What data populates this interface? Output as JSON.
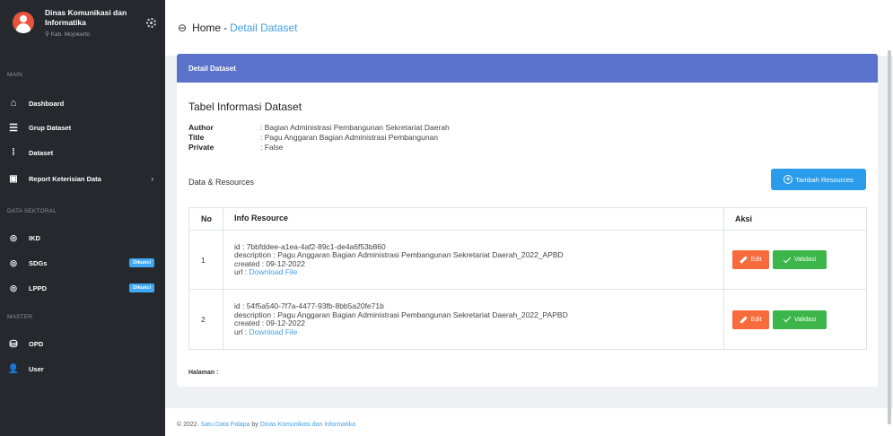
{
  "sidebar": {
    "org_name": "Dinas Komunikasi dan Informatika",
    "org_location": "Kab. Mojokerto",
    "sections": {
      "main": "MAIN",
      "data_sektoral": "DATA SEKTORAL",
      "master": "MASTER"
    },
    "items": [
      {
        "label": "Dashboard",
        "icon": "home-icon"
      },
      {
        "label": "Grup Dataset",
        "icon": "list-icon"
      },
      {
        "label": "Dataset",
        "icon": "bar-icon"
      },
      {
        "label": "Report Keterisian Data",
        "icon": "report-icon",
        "chevron": "›"
      },
      {
        "label": "IKD",
        "icon": "signal-icon"
      },
      {
        "label": "SDGs",
        "icon": "signal-icon",
        "badge": "Dikunci"
      },
      {
        "label": "LPPD",
        "icon": "signal-icon",
        "badge": "Dikunci"
      },
      {
        "label": "OPD",
        "icon": "database-icon"
      },
      {
        "label": "User",
        "icon": "user-icon"
      }
    ]
  },
  "topbar": {
    "home": "Home",
    "separator": "-",
    "current": "Detail Dataset"
  },
  "card": {
    "header": "Detail Dataset",
    "table_title": "Tabel Informasi Dataset",
    "meta": [
      {
        "key": "Author",
        "value": ": Bagian Administrasi Pembangunan Sekretariat Daerah"
      },
      {
        "key": "Title",
        "value": ": Pagu Anggaran Bagian Administrasi Pembangunan"
      },
      {
        "key": "Private",
        "value": ": False"
      }
    ],
    "resources_label": "Data & Resources",
    "add_button": "Tambah Resources",
    "columns": [
      "No",
      "Info Resource",
      "Aksi"
    ],
    "rows": [
      {
        "no": "1",
        "id": "id : 7bbfddee-a1ea-4af2-89c1-de4a6f53b860",
        "description": "description : Pagu Anggaran Bagian Administrasi Pembangunan Sekretariat Daerah_2022_APBD",
        "created": "created : 09-12-2022",
        "url_prefix": "url : ",
        "url_link": "Download File"
      },
      {
        "no": "2",
        "id": "id : 54f5a540-7f7a-4477-93fb-8bb5a20fe71b",
        "description": "description : Pagu Anggaran Bagian Administrasi Pembangunan Sekretariat Daerah_2022_PAPBD",
        "created": "created : 09-12-2022",
        "url_prefix": "url : ",
        "url_link": "Download File"
      }
    ],
    "edit_label": "Edit",
    "validate_label": "Validasi",
    "pagination_label": "Halaman :"
  },
  "footer": {
    "prefix": "© 2022. ",
    "app_link": "Satu Data Palapa",
    "by": " by ",
    "org_link": "Dinas Komunikasi dan Informatika"
  },
  "colors": {
    "sidebar_bg": "#25282d",
    "header_bg": "#5a72c9",
    "accent": "#2b9ceb",
    "edit": "#f76b3c",
    "validate": "#3cb54a",
    "badge": "#3fa9f5"
  }
}
